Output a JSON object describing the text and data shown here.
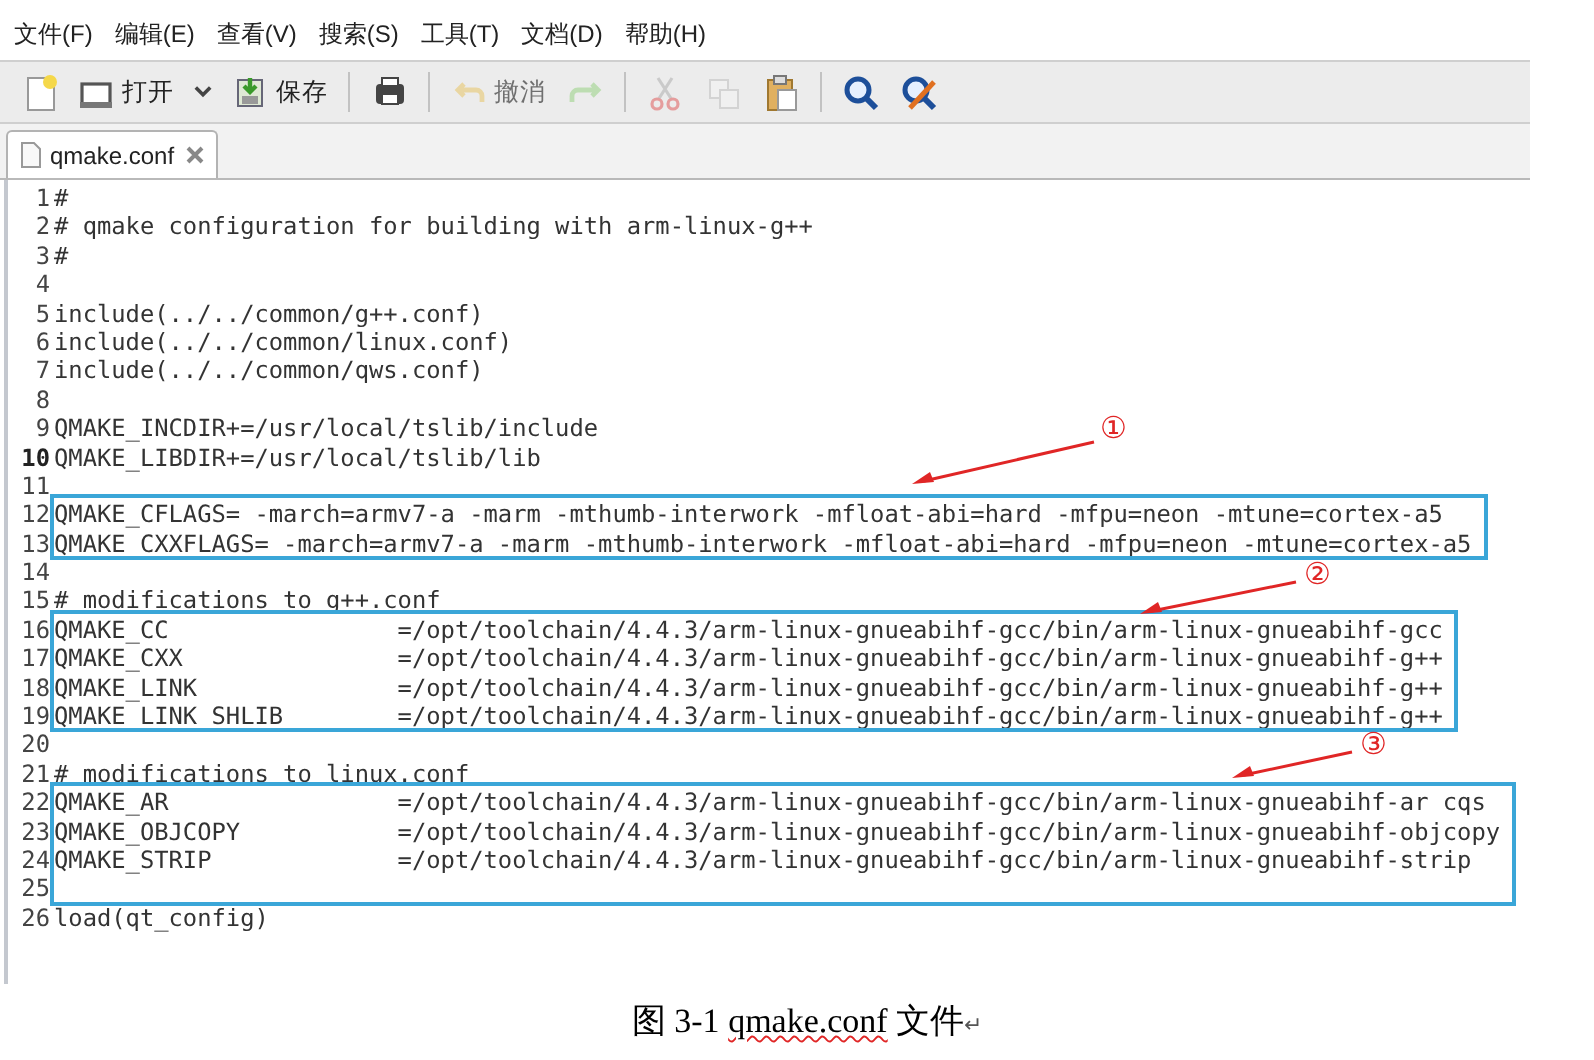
{
  "menu": [
    "文件(F)",
    "编辑(E)",
    "查看(V)",
    "搜索(S)",
    "工具(T)",
    "文档(D)",
    "帮助(H)"
  ],
  "toolbar": [
    {
      "kind": "new",
      "disabled": false
    },
    {
      "kind": "open",
      "label": "打开",
      "disabled": false
    },
    {
      "kind": "dropdown",
      "disabled": false
    },
    {
      "kind": "save",
      "label": "保存",
      "disabled": false
    },
    {
      "kind": "separator"
    },
    {
      "kind": "print",
      "disabled": false
    },
    {
      "kind": "separator"
    },
    {
      "kind": "undo",
      "label": "撤消",
      "disabled": true
    },
    {
      "kind": "redo",
      "disabled": true
    },
    {
      "kind": "separator"
    },
    {
      "kind": "cut",
      "disabled": true
    },
    {
      "kind": "copy",
      "disabled": true
    },
    {
      "kind": "paste",
      "disabled": false
    },
    {
      "kind": "separator"
    },
    {
      "kind": "find",
      "disabled": false
    },
    {
      "kind": "replace",
      "disabled": false
    }
  ],
  "tabs": [
    {
      "label": "qmake.conf",
      "selected": true
    }
  ],
  "code": [
    {
      "kind": "plain",
      "lines": [
        {
          "number": "1",
          "text": "#",
          "current": false
        },
        {
          "number": "2",
          "text": "# qmake configuration for building with arm-linux-g++",
          "current": false
        },
        {
          "number": "3",
          "text": "#",
          "current": false
        },
        {
          "number": "4",
          "current": false
        },
        {
          "number": "5",
          "text": "include(../../common/g++.conf)",
          "current": false
        },
        {
          "number": "6",
          "text": "include(../../common/linux.conf)",
          "current": false
        },
        {
          "number": "7",
          "text": "include(../../common/qws.conf)",
          "current": false
        },
        {
          "number": "8",
          "current": false
        },
        {
          "number": "9",
          "text": "QMAKE_INCDIR+=/usr/local/tslib/include",
          "current": false
        },
        {
          "number": "10",
          "text": "QMAKE_LIBDIR+=/usr/local/tslib/lib",
          "current": true
        },
        {
          "number": "11",
          "current": false
        }
      ]
    },
    {
      "kind": "boxed",
      "marker": "①",
      "lines": [
        {
          "number": "12",
          "text": "QMAKE_CFLAGS= -march=armv7-a -marm -mthumb-interwork -mfloat-abi=hard -mfpu=neon -mtune=cortex-a5",
          "current": false
        },
        {
          "number": "13",
          "text": "QMAKE_CXXFLAGS= -march=armv7-a -marm -mthumb-interwork -mfloat-abi=hard -mfpu=neon -mtune=cortex-a5",
          "current": false
        }
      ]
    },
    {
      "kind": "plain",
      "lines": [
        {
          "number": "14",
          "current": false
        },
        {
          "number": "15",
          "text": "# modifications to g++.conf",
          "current": false
        }
      ]
    },
    {
      "kind": "boxed",
      "marker": "②",
      "lines": [
        {
          "number": "16",
          "text": "QMAKE_CC                =/opt/toolchain/4.4.3/arm-linux-gnueabihf-gcc/bin/arm-linux-gnueabihf-gcc",
          "current": false
        },
        {
          "number": "17",
          "text": "QMAKE_CXX               =/opt/toolchain/4.4.3/arm-linux-gnueabihf-gcc/bin/arm-linux-gnueabihf-g++",
          "current": false
        },
        {
          "number": "18",
          "text": "QMAKE_LINK              =/opt/toolchain/4.4.3/arm-linux-gnueabihf-gcc/bin/arm-linux-gnueabihf-g++",
          "current": false
        },
        {
          "number": "19",
          "text": "QMAKE_LINK_SHLIB        =/opt/toolchain/4.4.3/arm-linux-gnueabihf-gcc/bin/arm-linux-gnueabihf-g++",
          "current": false
        }
      ]
    },
    {
      "kind": "plain",
      "lines": [
        {
          "number": "20",
          "current": false
        },
        {
          "number": "21",
          "text": "# modifications to linux.conf",
          "current": false
        }
      ]
    },
    {
      "kind": "boxed",
      "marker": "③",
      "lines": [
        {
          "number": "22",
          "text": "QMAKE_AR                =/opt/toolchain/4.4.3/arm-linux-gnueabihf-gcc/bin/arm-linux-gnueabihf-ar cqs",
          "current": false
        },
        {
          "number": "23",
          "text": "QMAKE_OBJCOPY           =/opt/toolchain/4.4.3/arm-linux-gnueabihf-gcc/bin/arm-linux-gnueabihf-objcopy",
          "current": false
        },
        {
          "number": "24",
          "text": "QMAKE_STRIP             =/opt/toolchain/4.4.3/arm-linux-gnueabihf-gcc/bin/arm-linux-gnueabihf-strip",
          "current": false
        },
        {
          "number": "25",
          "current": false
        }
      ]
    },
    {
      "kind": "plain",
      "lines": [
        {
          "number": "26",
          "text": "load(qt_config)",
          "current": false
        }
      ]
    }
  ],
  "caption": {
    "parts": [
      {
        "text": "图 3-1 ",
        "misspelled": false
      },
      {
        "text": "qmake.conf",
        "misspelled": true
      },
      {
        "text": " 文件",
        "misspelled": false
      }
    ],
    "paragraph_mark": "↵"
  }
}
